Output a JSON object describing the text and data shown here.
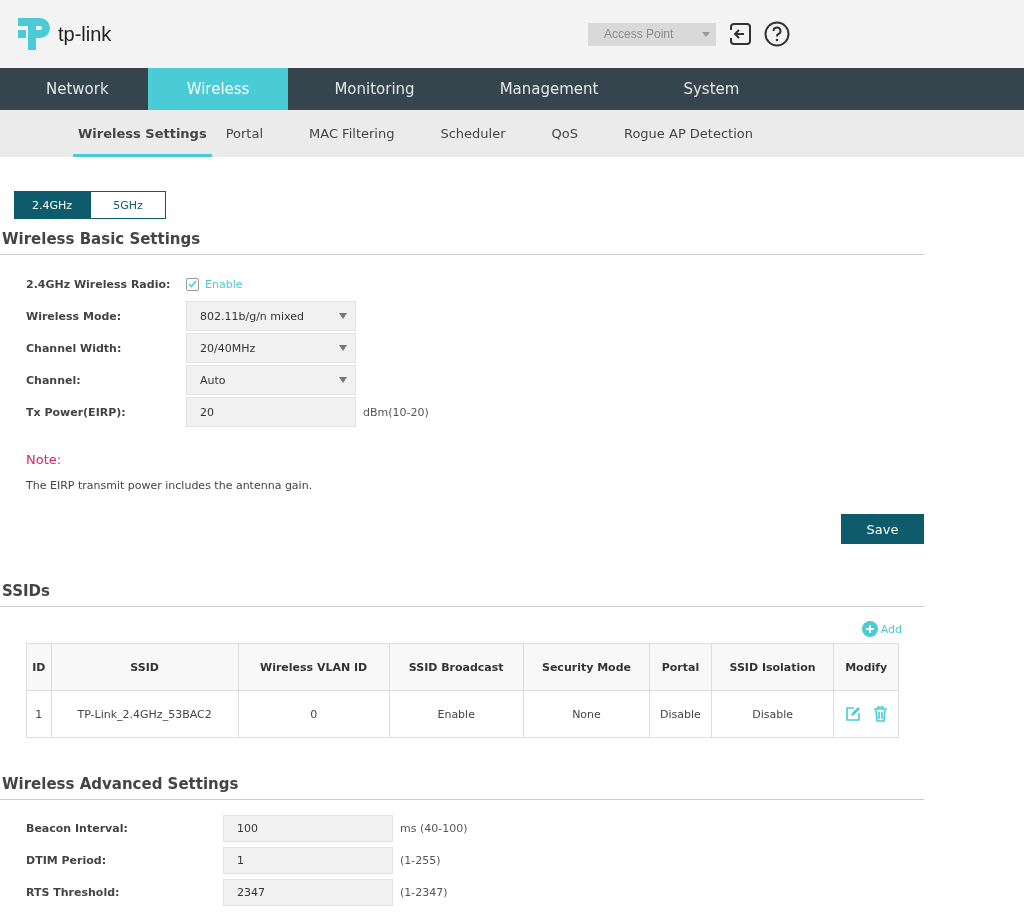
{
  "header": {
    "logo": "tp-link",
    "mode_select": {
      "value": "Access Point",
      "disabled": true
    }
  },
  "nav": [
    {
      "label": "Network",
      "selected": false
    },
    {
      "label": "Wireless",
      "selected": true
    },
    {
      "label": "Monitoring",
      "selected": false
    },
    {
      "label": "Management",
      "selected": false
    },
    {
      "label": "System",
      "selected": false
    }
  ],
  "subnav": [
    {
      "label": "Wireless Settings",
      "selected": true
    },
    {
      "label": "Portal",
      "selected": false
    },
    {
      "label": "MAC Filtering",
      "selected": false
    },
    {
      "label": "Scheduler",
      "selected": false
    },
    {
      "label": "QoS",
      "selected": false
    },
    {
      "label": "Rogue AP Detection",
      "selected": false
    }
  ],
  "bands": [
    {
      "label": "2.4GHz",
      "selected": true
    },
    {
      "label": "5GHz",
      "selected": false
    }
  ],
  "basic": {
    "title": "Wireless Basic Settings",
    "fields": [
      {
        "kind": "checkbox",
        "label": "2.4GHz Wireless Radio:",
        "option": "Enable",
        "checked": true
      },
      {
        "kind": "select",
        "label": "Wireless Mode:",
        "value": "802.11b/g/n mixed"
      },
      {
        "kind": "select",
        "label": "Channel Width:",
        "value": "20/40MHz"
      },
      {
        "kind": "select",
        "label": "Channel:",
        "value": "Auto"
      },
      {
        "kind": "text",
        "label": "Tx Power(EIRP):",
        "value": "20",
        "hint": "dBm(10-20)"
      }
    ],
    "note_label": "Note:",
    "note": "The EIRP transmit power includes the antenna gain.",
    "save": "Save"
  },
  "ssids": {
    "title": "SSIDs",
    "add": "Add",
    "columns": [
      "ID",
      "SSID",
      "Wireless VLAN ID",
      "SSID Broadcast",
      "Security Mode",
      "Portal",
      "SSID Isolation",
      "Modify"
    ],
    "rows": [
      [
        "1",
        "TP-Link_2.4GHz_53BAC2",
        "0",
        "Enable",
        "None",
        "Disable",
        "Disable"
      ]
    ]
  },
  "advanced": {
    "title": "Wireless Advanced Settings",
    "fields": [
      {
        "kind": "text",
        "label": "Beacon Interval:",
        "value": "100",
        "hint": "ms (40-100)"
      },
      {
        "kind": "text",
        "label": "DTIM Period:",
        "value": "1",
        "hint": "(1-255)"
      },
      {
        "kind": "text",
        "label": "RTS Threshold:",
        "value": "2347",
        "hint": "(1-2347)"
      }
    ]
  }
}
